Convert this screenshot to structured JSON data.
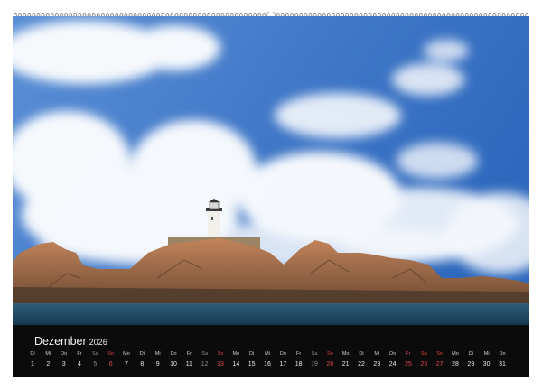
{
  "calendar": {
    "month": "Dezember",
    "year": "2026",
    "weekdays": [
      "Di",
      "Mi",
      "Do",
      "Fr",
      "Sa",
      "So",
      "Mo",
      "Di",
      "Mi",
      "Do",
      "Fr",
      "Sa",
      "So",
      "Mo",
      "Di",
      "Mi",
      "Do",
      "Fr",
      "Sa",
      "So",
      "Mo",
      "Di",
      "Mi",
      "Do",
      "Fr",
      "Sa",
      "So",
      "Mo",
      "Di",
      "Mi",
      "Do"
    ],
    "days": [
      "1",
      "2",
      "3",
      "4",
      "5",
      "6",
      "7",
      "8",
      "9",
      "10",
      "11",
      "12",
      "13",
      "14",
      "15",
      "16",
      "17",
      "18",
      "19",
      "20",
      "21",
      "22",
      "23",
      "24",
      "25",
      "26",
      "27",
      "28",
      "29",
      "30",
      "31"
    ],
    "holidays": [
      "25",
      "26"
    ]
  },
  "colors": {
    "strip": "#0b0b0b",
    "sunday": "#e0454b",
    "saturday": "#8d8d8d",
    "sky": "#3f76c6"
  },
  "icons": {
    "binding": "spiral-binding-icon",
    "hanger": "hanger-hole-icon"
  }
}
